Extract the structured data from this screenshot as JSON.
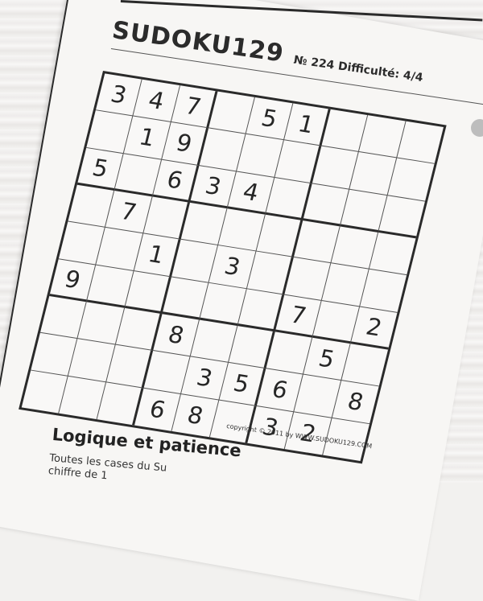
{
  "header": {
    "brand": "SUDOKU129",
    "issue": "№ 224 Difficulté: 4/4"
  },
  "puzzle": {
    "rows": [
      [
        "3",
        "4",
        "7",
        "",
        "5",
        "1",
        "",
        "",
        ""
      ],
      [
        "",
        "1",
        "9",
        "",
        "",
        "",
        "",
        "",
        ""
      ],
      [
        "5",
        "",
        "6",
        "3",
        "4",
        "",
        "",
        "",
        ""
      ],
      [
        "",
        "7",
        "",
        "",
        "",
        "",
        "",
        "",
        ""
      ],
      [
        "",
        "",
        "1",
        "",
        "3",
        "",
        "",
        "",
        ""
      ],
      [
        "9",
        "",
        "",
        "",
        "",
        "",
        "7",
        "",
        "2"
      ],
      [
        "",
        "",
        "",
        "8",
        "",
        "",
        "",
        "5",
        ""
      ],
      [
        "",
        "",
        "",
        "",
        "3",
        "5",
        "6",
        "",
        "8"
      ],
      [
        "",
        "",
        "",
        "6",
        "8",
        "",
        "3",
        "2",
        ""
      ]
    ]
  },
  "footer": {
    "copyright": "copyright © 2011 by WWW.SUDOKU129.COM",
    "section_title": "Logique et patience",
    "body_line1": "Toutes les cases du Su",
    "body_line2": "chiffre de 1"
  },
  "colors": {
    "ink": "#262626",
    "paper": "#f7f6f4"
  }
}
